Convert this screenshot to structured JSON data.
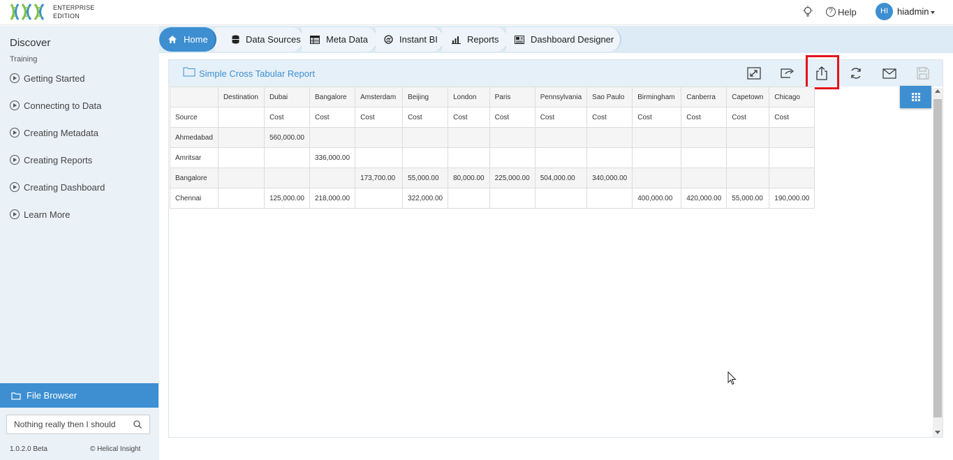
{
  "header": {
    "edition_line1": "ENTERPRISE",
    "edition_line2": "EDITION",
    "help_label": "Help",
    "avatar_initials": "HI",
    "user_name": "hiadmin"
  },
  "sidebar": {
    "title": "Discover",
    "subtitle": "Training",
    "items": [
      {
        "label": "Getting Started"
      },
      {
        "label": "Connecting to Data"
      },
      {
        "label": "Creating Metadata"
      },
      {
        "label": "Creating Reports"
      },
      {
        "label": "Creating Dashboard"
      },
      {
        "label": "Learn More"
      }
    ],
    "file_browser_label": "File Browser",
    "search_value": "Nothing really then I should",
    "version": "1.0.2.0 Beta",
    "copyright": "© Helical Insight"
  },
  "tabs": [
    {
      "label": "Home",
      "icon": "home-icon"
    },
    {
      "label": "Data Sources",
      "icon": "database-icon"
    },
    {
      "label": "Meta Data",
      "icon": "table-icon"
    },
    {
      "label": "Instant BI",
      "icon": "instant-bi-icon"
    },
    {
      "label": "Reports",
      "icon": "bar-chart-icon"
    },
    {
      "label": "Dashboard Designer",
      "icon": "dashboard-icon"
    }
  ],
  "report": {
    "title": "Simple Cross Tabular Report",
    "toolbar": [
      "expand-icon",
      "share-icon",
      "export-icon",
      "refresh-icon",
      "email-icon",
      "save-icon"
    ],
    "header_row_1": [
      "",
      "Destination",
      "Dubai",
      "Bangalore",
      "Amsterdam",
      "Beijing",
      "London",
      "Paris",
      "Pennsylvania",
      "Sao Paulo",
      "Birmingham",
      "Canberra",
      "Capetown",
      "Chicago"
    ],
    "header_row_2": [
      "Source",
      "",
      "Cost",
      "Cost",
      "Cost",
      "Cost",
      "Cost",
      "Cost",
      "Cost",
      "Cost",
      "Cost",
      "Cost",
      "Cost",
      "Cost"
    ],
    "rows": [
      [
        "Ahmedabad",
        "",
        "560,000.00",
        "",
        "",
        "",
        "",
        "",
        "",
        "",
        "",
        "",
        "",
        ""
      ],
      [
        "Amritsar",
        "",
        "",
        "336,000.00",
        "",
        "",
        "",
        "",
        "",
        "",
        "",
        "",
        "",
        ""
      ],
      [
        "Bangalore",
        "",
        "",
        "",
        "173,700.00",
        "55,000.00",
        "80,000.00",
        "225,000.00",
        "504,000.00",
        "340,000.00",
        "",
        "",
        "",
        ""
      ],
      [
        "Chennai",
        "",
        "125,000.00",
        "218,000.00",
        "",
        "322,000.00",
        "",
        "",
        "",
        "",
        "400,000.00",
        "420,000.00",
        "55,000.00",
        "190,000.00"
      ]
    ]
  },
  "colors": {
    "accent": "#3d8fd1",
    "highlight_border": "#e0141e",
    "sidebar_bg": "#eaf1f7"
  }
}
